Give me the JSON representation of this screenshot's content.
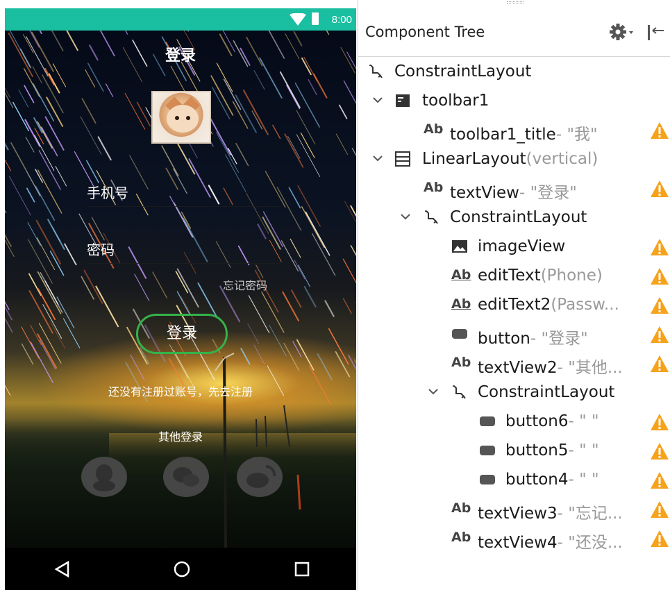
{
  "phone": {
    "status_time": "8:00",
    "title": "登录",
    "phone_label": "手机号",
    "password_label": "密码",
    "forgot_password": "忘记密码",
    "login_button": "登录",
    "register_prompt": "还没有注册过账号，先去注册",
    "other_login": "其他登录",
    "social_icons": [
      "qq-icon",
      "wechat-icon",
      "weibo-icon"
    ],
    "nav_icons": [
      "back-icon",
      "home-icon",
      "recents-icon"
    ],
    "colors": {
      "status_bar": "#19bfa0",
      "login_button_border": "#34b349"
    }
  },
  "panel": {
    "title": "Component Tree",
    "warning_color": "#f7a21b",
    "rows": [
      {
        "name": "ConstraintLayout",
        "extra": "",
        "dim": "",
        "icon": "constraint-icon",
        "warn": false
      },
      {
        "name": "toolbar1",
        "extra": "",
        "dim": "",
        "icon": "toolbar-icon",
        "warn": false
      },
      {
        "name": "toolbar1_title",
        "extra": "- ",
        "dim": "\"我\"",
        "icon": "textview-icon",
        "warn": true
      },
      {
        "name": "LinearLayout",
        "extra": "",
        "dim": "(vertical)",
        "icon": "linear-layout-icon",
        "warn": false
      },
      {
        "name": "textView",
        "extra": "- ",
        "dim": "\"登录\"",
        "icon": "textview-icon",
        "warn": true
      },
      {
        "name": "ConstraintLayout",
        "extra": "",
        "dim": "",
        "icon": "constraint-icon",
        "warn": false
      },
      {
        "name": "imageView",
        "extra": "",
        "dim": "",
        "icon": "imageview-icon",
        "warn": true
      },
      {
        "name": "editText",
        "extra": "",
        "dim": "(Phone)",
        "icon": "edittext-icon",
        "warn": true
      },
      {
        "name": "editText2",
        "extra": "",
        "dim": "(Passw...",
        "icon": "edittext-icon",
        "warn": true
      },
      {
        "name": "button",
        "extra": "- ",
        "dim": "\"登录\"",
        "icon": "button-icon",
        "warn": true
      },
      {
        "name": "textView2",
        "extra": "- ",
        "dim": "\"其他...",
        "icon": "textview-icon",
        "warn": true
      },
      {
        "name": "ConstraintLayout",
        "extra": "",
        "dim": "",
        "icon": "constraint-icon",
        "warn": false
      },
      {
        "name": "button6",
        "extra": "- ",
        "dim": "\" \"",
        "icon": "button-icon",
        "warn": true
      },
      {
        "name": "button5",
        "extra": "- ",
        "dim": "\" \"",
        "icon": "button-icon",
        "warn": true
      },
      {
        "name": "button4",
        "extra": "- ",
        "dim": "\" \"",
        "icon": "button-icon",
        "warn": true
      },
      {
        "name": "textView3",
        "extra": "- ",
        "dim": "\"忘记...",
        "icon": "textview-icon",
        "warn": true
      },
      {
        "name": "textView4",
        "extra": "- ",
        "dim": "\"还没...",
        "icon": "textview-icon",
        "warn": true
      }
    ]
  }
}
